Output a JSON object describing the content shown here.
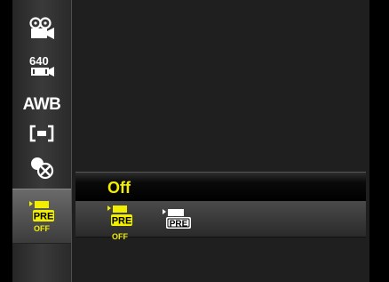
{
  "sidebar": {
    "items": [
      {
        "icon": "movie-camera-icon",
        "label": ""
      },
      {
        "icon": "resolution-640-icon",
        "label": "640"
      },
      {
        "icon": "white-balance-icon",
        "label": "AWB"
      },
      {
        "icon": "metering-icon",
        "label": ""
      },
      {
        "icon": "effect-off-icon",
        "label": ""
      },
      {
        "icon": "pre-record-off-icon",
        "label": "PRE",
        "sub": "OFF",
        "selected": true
      }
    ]
  },
  "option": {
    "title": "Off",
    "choices": [
      {
        "icon": "pre-record-off-icon",
        "label": "PRE",
        "sub": "OFF",
        "selected": true
      },
      {
        "icon": "pre-record-on-icon",
        "label": "PRE",
        "selected": false
      }
    ]
  },
  "colors": {
    "accent": "#f2ee00",
    "panel": "#1f1f1f"
  }
}
